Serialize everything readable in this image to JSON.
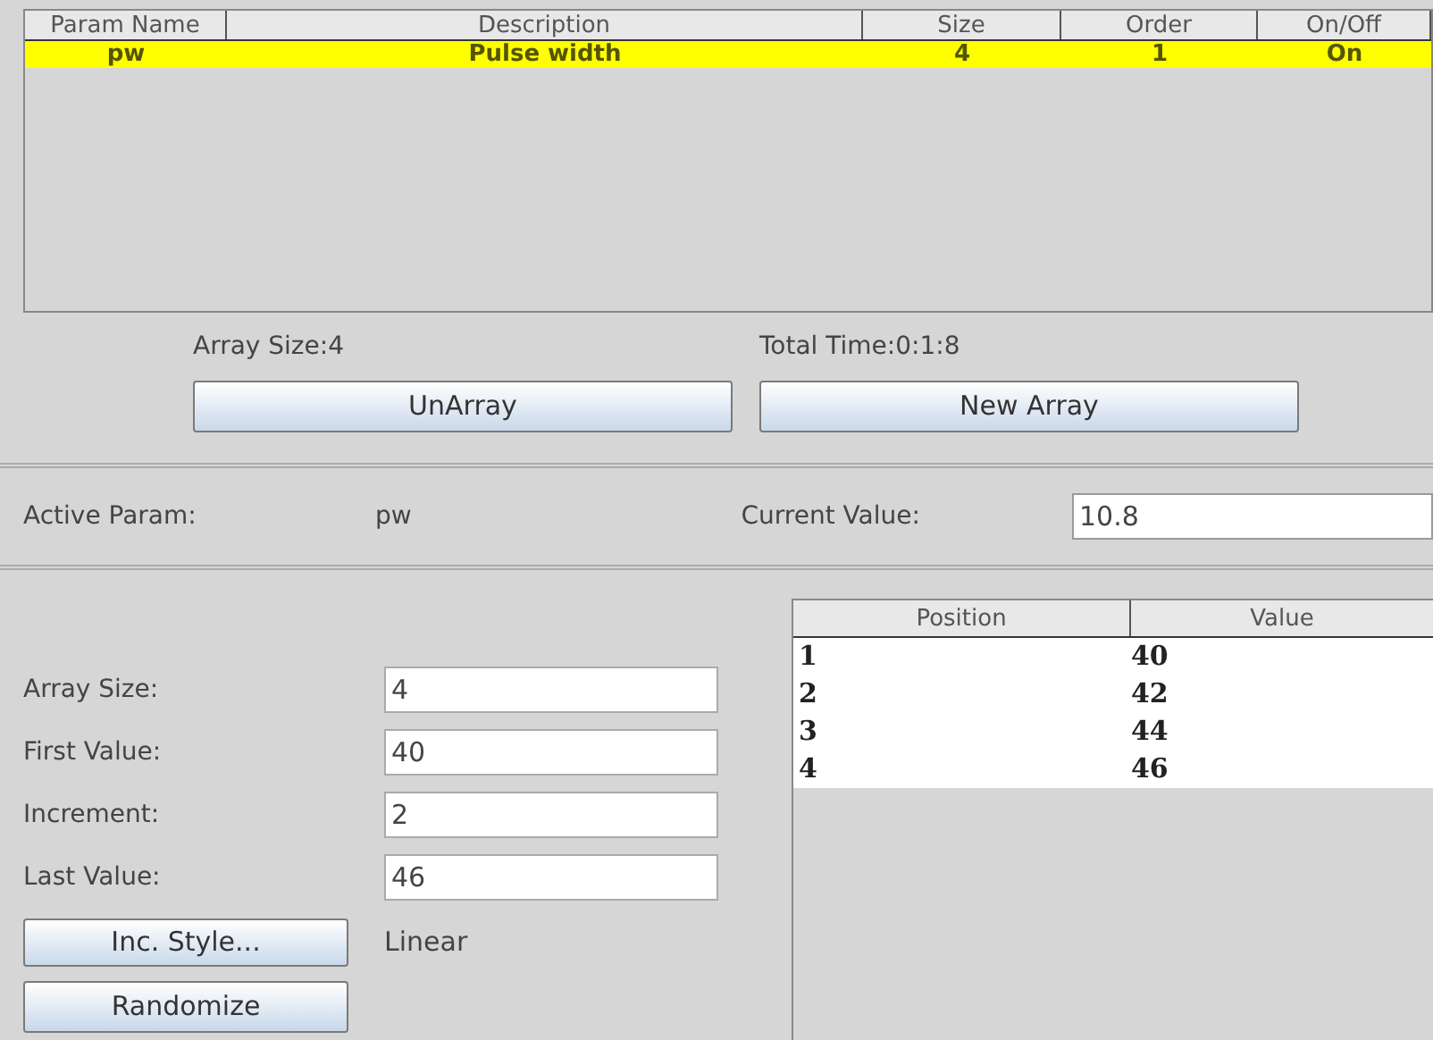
{
  "param_table": {
    "columns": [
      "Param Name",
      "Description",
      "Size",
      "Order",
      "On/Off"
    ],
    "rows": [
      {
        "cells": [
          "pw",
          "Pulse width",
          "4",
          "1",
          "On"
        ],
        "selected": true
      }
    ]
  },
  "array_size_info": "Array Size:4",
  "total_time": "Total Time:0:1:8",
  "buttons": [
    "UnArray",
    "New Array"
  ],
  "active_param": {
    "label": "Active Param:",
    "value": "pw"
  },
  "current_value": {
    "label": "Current Value:",
    "value": "10.8"
  },
  "fields": [
    {
      "label": "Array Size:",
      "value": "4"
    },
    {
      "label": "First Value:",
      "value": "40"
    },
    {
      "label": "Increment:",
      "value": "2"
    },
    {
      "label": "Last Value:",
      "value": "46"
    }
  ],
  "inc_style": {
    "button": "Inc. Style...",
    "value": "Linear"
  },
  "randomize_button": "Randomize",
  "value_table": {
    "columns": [
      "Position",
      "Value"
    ],
    "rows": [
      [
        "1",
        "40"
      ],
      [
        "2",
        "42"
      ],
      [
        "3",
        "44"
      ],
      [
        "4",
        "46"
      ]
    ]
  }
}
